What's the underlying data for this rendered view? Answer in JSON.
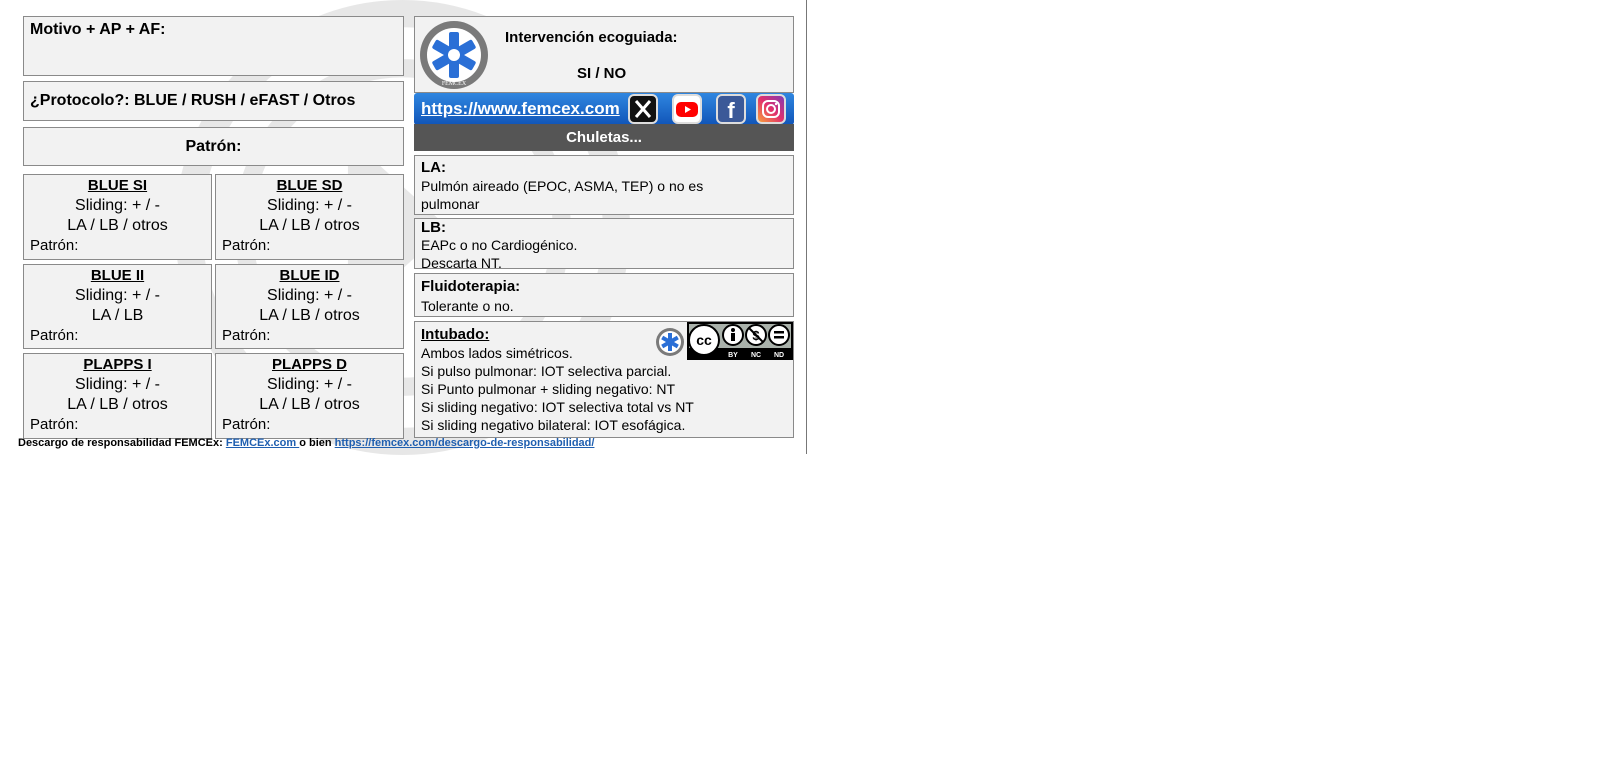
{
  "left": {
    "motivo_label": "Motivo + AP + AF:",
    "protocolo_label": "¿Protocolo?: BLUE / RUSH / eFAST / Otros",
    "patron_label": "Patrón:",
    "cells": [
      {
        "title": "BLUE SI",
        "line1": "Sliding: + / -",
        "line2": "LA / LB / otros",
        "patron": "Patrón:"
      },
      {
        "title": "BLUE SD",
        "line1": "Sliding: + / -",
        "line2": "LA / LB / otros",
        "patron": "Patrón:"
      },
      {
        "title": "BLUE II",
        "line1": "Sliding: + / -",
        "line2": "LA / LB",
        "patron": "Patrón:"
      },
      {
        "title": "BLUE ID",
        "line1": "Sliding: + / -",
        "line2": "LA / LB / otros",
        "patron": "Patrón:"
      },
      {
        "title": "PLAPPS I",
        "line1": "Sliding: + / -",
        "line2": "LA / LB / otros",
        "patron": "Patrón:"
      },
      {
        "title": "PLAPPS D",
        "line1": "Sliding: + / -",
        "line2": "LA / LB / otros",
        "patron": "Patrón:"
      }
    ]
  },
  "right": {
    "logo_text": "FEMCEX",
    "intervencion_label": "Intervención ecoguiada:",
    "si_no": "SI / NO",
    "url": "https://www.femcex.com",
    "social": [
      {
        "icon": "x-icon",
        "color": "#111111"
      },
      {
        "icon": "youtube-icon",
        "color": "#ff0000"
      },
      {
        "icon": "facebook-icon",
        "color": "#3b5998"
      },
      {
        "icon": "instagram-icon",
        "color": "#c13584"
      }
    ],
    "chuletas": "Chuletas...",
    "la": {
      "title": "LA:",
      "lines": [
        "Pulmón aireado (EPOC, ASMA, TEP) o no es",
        "pulmonar"
      ]
    },
    "lb": {
      "title": "LB:",
      "lines": [
        "EAPc o no Cardiogénico.",
        "Descarta NT."
      ]
    },
    "fluido": {
      "title": "Fluidoterapia:",
      "lines": [
        "Tolerante o no."
      ]
    },
    "intubado": {
      "title": "Intubado:",
      "lines": [
        "Ambos lados simétricos.",
        "Si pulso pulmonar: IOT selectiva parcial.",
        "Si Punto pulmonar + sliding negativo: NT",
        "Si sliding negativo: IOT selectiva total vs NT",
        "Si sliding negativo bilateral: IOT esofágica."
      ]
    },
    "cc": {
      "by": "BY",
      "nc": "NC",
      "nd": "ND",
      "cc": "cc"
    }
  },
  "footer": {
    "prefix": "Descargo de responsabilidad FEMCEx: ",
    "link1": "FEMCEx.com ",
    "middle": "o bien ",
    "link2": "https://femcex.com/descargo-de-responsabilidad/"
  }
}
